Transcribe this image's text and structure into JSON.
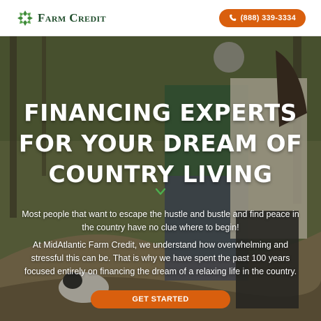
{
  "header": {
    "logo_text": "Farm Credit",
    "phone_label": "(888) 339-3334"
  },
  "hero": {
    "headline": "FINANCING EXPERTS FOR YOUR DREAM OF COUNTRY LIVING",
    "paragraph_1": "Most people that want to escape the hustle and bustle and find peace in the country have no clue where to begin!",
    "paragraph_2": "At MidAtlantic Farm Credit, we understand how overwhelming and stressful this can be. That is why we have spent the past 100 years focused entirely on financing the dream of a relaxing life in the country.",
    "cta_label": "GET STARTED"
  },
  "colors": {
    "accent": "#d95f0e",
    "brand_green": "#1f4d2b",
    "logo_green": "#3f8a3a",
    "chevron_green": "#4caf50"
  },
  "icons": {
    "logo": "leaf-cluster-logo",
    "phone": "phone-icon",
    "scroll": "chevron-down-icon"
  }
}
